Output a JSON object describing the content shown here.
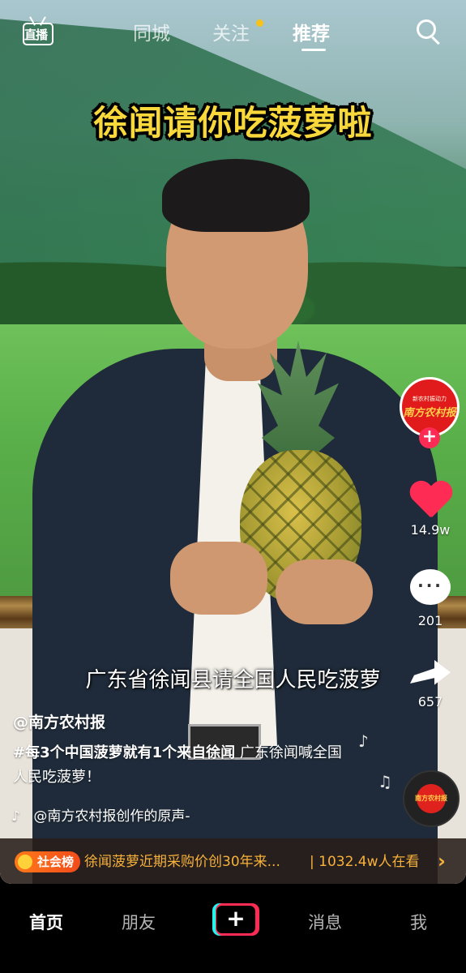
{
  "top_nav": {
    "live_label": "直播",
    "tabs": [
      {
        "label": "同城"
      },
      {
        "label": "关注"
      },
      {
        "label": "推荐"
      }
    ]
  },
  "video": {
    "title_caption": "徐闻请你吃菠萝啦",
    "subtitle": "广东省徐闻县请全国人民吃菠萝"
  },
  "rail": {
    "avatar_small_text": "新农村振动力",
    "avatar_text": "南方农村报",
    "likes": "14.9w",
    "comments": "201",
    "shares": "657"
  },
  "post": {
    "author": "@南方农村报",
    "hashtag": "#每3个中国菠萝就有1个来自徐闻",
    "description": " 广东徐闻喊全国人民吃菠萝！",
    "music": "@南方农村报创作的原声-"
  },
  "hot": {
    "badge": "社会榜",
    "text": "徐闻菠萝近期采购价创30年来...",
    "count": "| 1032.4w人在看"
  },
  "bottom_nav": {
    "home": "首页",
    "friends": "朋友",
    "plus": "+",
    "messages": "消息",
    "me": "我"
  },
  "colors": {
    "accent": "#fe2c55",
    "caption_yellow": "#f8d83a",
    "hot_orange": "#f8b13a"
  }
}
